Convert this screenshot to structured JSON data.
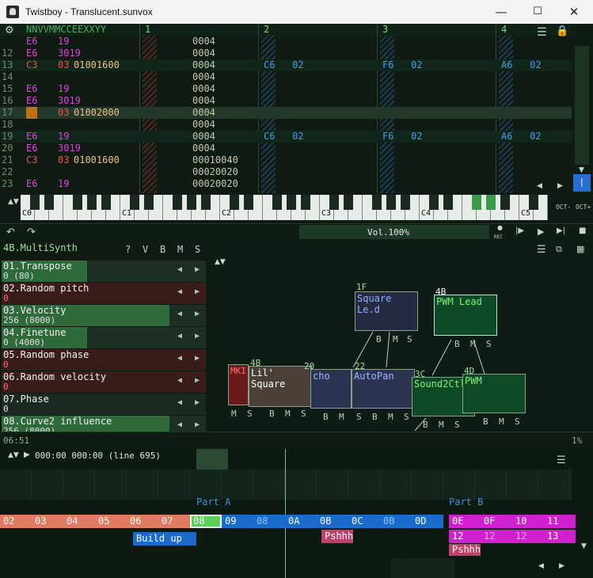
{
  "window": {
    "title": "Twistboy - Translucent.sunvox",
    "minimize": "—",
    "maximize": "☐",
    "close": "✕"
  },
  "pattern": {
    "header": "NNVVMMCCEEXXYY",
    "tracks": [
      "1",
      "2",
      "3",
      "4"
    ],
    "rows": [
      {
        "n": "",
        "a": "E6",
        "b": "19",
        "fx": "",
        "num": "0004",
        "t2": "",
        "t3": "",
        "t4": ""
      },
      {
        "n": "12",
        "a": "E6",
        "b": "3019",
        "fx": "",
        "num": "0004",
        "t2": "",
        "t3": "",
        "t4": ""
      },
      {
        "n": "13",
        "a": "C3",
        "b": "03",
        "fx": "01001600",
        "num": "0004",
        "t2": "C6   02",
        "t3": "F6   02",
        "t4": "A6   02"
      },
      {
        "n": "14",
        "a": "",
        "b": "",
        "fx": "",
        "num": "0004",
        "t2": "",
        "t3": "",
        "t4": ""
      },
      {
        "n": "15",
        "a": "E6",
        "b": "19",
        "fx": "",
        "num": "0004",
        "t2": "",
        "t3": "",
        "t4": ""
      },
      {
        "n": "16",
        "a": "E6",
        "b": "3019",
        "fx": "",
        "num": "0004",
        "t2": "",
        "t3": "",
        "t4": ""
      },
      {
        "n": "17",
        "a": "C3",
        "b": "03",
        "fx": "01002000",
        "num": "0004",
        "t2": "",
        "t3": "",
        "t4": ""
      },
      {
        "n": "18",
        "a": "",
        "b": "",
        "fx": "",
        "num": "0004",
        "t2": "",
        "t3": "",
        "t4": ""
      },
      {
        "n": "19",
        "a": "E6",
        "b": "19",
        "fx": "",
        "num": "0004",
        "t2": "C6   02",
        "t3": "F6   02",
        "t4": "A6   02"
      },
      {
        "n": "20",
        "a": "E6",
        "b": "3019",
        "fx": "",
        "num": "0004",
        "t2": "",
        "t3": "",
        "t4": ""
      },
      {
        "n": "21",
        "a": "C3",
        "b": "03",
        "fx": "01001600",
        "num": "00010040",
        "t2": "",
        "t3": "",
        "t4": ""
      },
      {
        "n": "22",
        "a": "",
        "b": "",
        "fx": "",
        "num": "00020020",
        "t2": "",
        "t3": "",
        "t4": ""
      },
      {
        "n": "23",
        "a": "E6",
        "b": "19",
        "fx": "",
        "num": "00020020",
        "t2": "",
        "t3": "",
        "t4": ""
      }
    ]
  },
  "piano": {
    "octaves": [
      "C0",
      "C1",
      "C2",
      "C3",
      "C4",
      "C5"
    ],
    "oct_minus": "OCT-",
    "oct_plus": "OCT+"
  },
  "transport": {
    "volume": "Vol.100%",
    "rec": "REC"
  },
  "synth": {
    "name": "4B.MultiSynth",
    "flags": [
      "?",
      "V",
      "B",
      "M",
      "S"
    ],
    "controllers": [
      {
        "name": "01.Transpose",
        "value": "0 (80)",
        "fill": 0.42,
        "kind": "green"
      },
      {
        "name": "02.Random pitch",
        "value": "0",
        "fill": 0.0,
        "kind": "red"
      },
      {
        "name": "03.Velocity",
        "value": "256 (8000)",
        "fill": 0.82,
        "kind": "green"
      },
      {
        "name": "04.Finetune",
        "value": "0 (4000)",
        "fill": 0.42,
        "kind": "green"
      },
      {
        "name": "05.Random phase",
        "value": "0",
        "fill": 0.0,
        "kind": "red"
      },
      {
        "name": "06.Random velocity",
        "value": "0",
        "fill": 0.0,
        "kind": "red"
      },
      {
        "name": "07.Phase",
        "value": "0",
        "fill": 0.0,
        "kind": "dark"
      },
      {
        "name": "08.Curve2 influence",
        "value": "256 (8000)",
        "fill": 0.82,
        "kind": "green"
      }
    ]
  },
  "modules": {
    "items": [
      {
        "id": "1F",
        "name": "Square Le.d"
      },
      {
        "id": "4B",
        "name": "PWM Lead"
      },
      {
        "id": "4B",
        "name": "Lil' Square"
      },
      {
        "id": "20",
        "name": "cho"
      },
      {
        "id": "22",
        "name": "AutoPan"
      },
      {
        "id": "3C",
        "name": "Sound2Ctl"
      },
      {
        "id": "4D",
        "name": "PWM"
      },
      {
        "id": "",
        "name": "MKI"
      }
    ],
    "port_b": "B",
    "port_m": "M",
    "port_s": "S"
  },
  "timebar": {
    "left": "06:51",
    "right": "1%"
  },
  "timeline": {
    "position": "000:00 000:00 (line 695)",
    "part_a": "Part A",
    "part_b": "Part B",
    "seq1": [
      "02",
      "03",
      "04",
      "05",
      "06",
      "07",
      "08",
      "09",
      "08",
      "0A",
      "0B",
      "0C",
      "0B",
      "0D"
    ],
    "seq2": [
      "0E",
      "0F",
      "10",
      "11"
    ],
    "seq3": [
      "12",
      "12",
      "12",
      "13"
    ],
    "build_up": "Build up",
    "pshhh1": "Pshhh",
    "pshhh2": "Pshhh"
  }
}
